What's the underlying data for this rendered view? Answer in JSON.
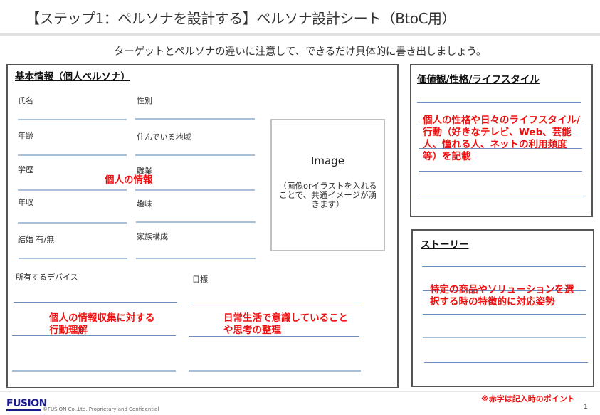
{
  "header": {
    "title": "【ステップ1：ペルソナを設計する】ペルソナ設計シート（BtoC用）",
    "subtitle": "ターゲットとペルソナの違いに注意して、できるだけ具体的に書き出しましょう。"
  },
  "basic_info": {
    "heading": "基本情報（個人ペルソナ）",
    "fields": {
      "name": "氏名",
      "gender": "性別",
      "age": "年齢",
      "region": "住んでいる地域",
      "education": "学歴",
      "occupation": "職業",
      "income": "年収",
      "hobby": "趣味",
      "marriage": "結婚 有/無",
      "family": "家族構成",
      "devices": "所有するデバイス",
      "goal": "目標"
    },
    "hint_personal": "個人の情報",
    "hint_devices": [
      "個人の情報収集に対する",
      "行動理解"
    ],
    "hint_goal": [
      "日常生活で意識していること",
      "や思考の整理"
    ],
    "image_placeholder": {
      "title": "Image",
      "description": "（画像orイラストを入れることで、共通イメージが湧きます）"
    }
  },
  "values_panel": {
    "heading": "価値観/性格/ライフスタイル",
    "hint": "個人の性格や日々のライフスタイル/行動（好きなテレビ、Web、芸能人、憧れる人、ネットの利用頻度等）を記載"
  },
  "story_panel": {
    "heading": "ストーリー",
    "hint": "特定の商品やソリューションを選択する時の特徴的に対応姿勢"
  },
  "footer": {
    "logo": "FUSION",
    "copyright": "©FUSION Co,.Ltd.  Proprietary  and Confidential",
    "note": "※赤字は記入時のポイント",
    "page_number": "1"
  }
}
